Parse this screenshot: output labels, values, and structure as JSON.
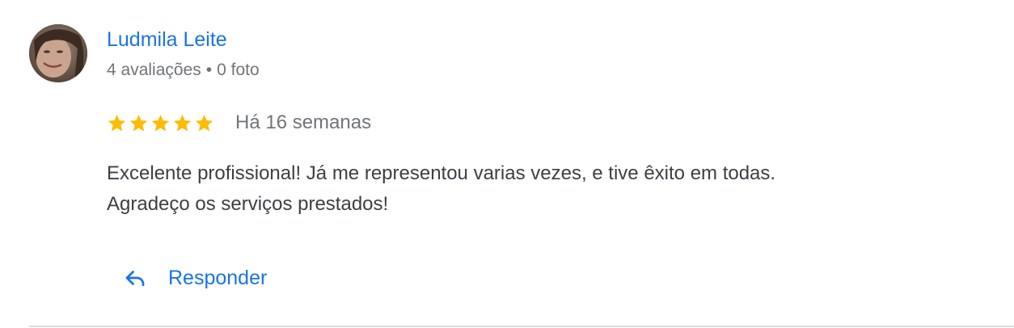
{
  "review": {
    "author": {
      "name": "Ludmila Leite",
      "reviews_count": "4 avaliações",
      "separator": "•",
      "photos_count": "0 foto",
      "avatar_icon": "user-avatar-photo"
    },
    "rating": {
      "stars": 5,
      "max_stars": 5,
      "star_color": "#fbbc04",
      "star_icon": "star-icon"
    },
    "time": "Há 16 semanas",
    "text_lines": [
      "Excelente profissional! Já me representou varias vezes, e tive êxito em todas.",
      "Agradeço os serviços prestados!"
    ],
    "reply": {
      "label": "Responder",
      "icon": "reply-arrow-icon"
    }
  },
  "colors": {
    "link": "#1a73e8",
    "secondary_text": "#70757a",
    "body_text": "#3c4043",
    "divider": "#dadce0"
  }
}
